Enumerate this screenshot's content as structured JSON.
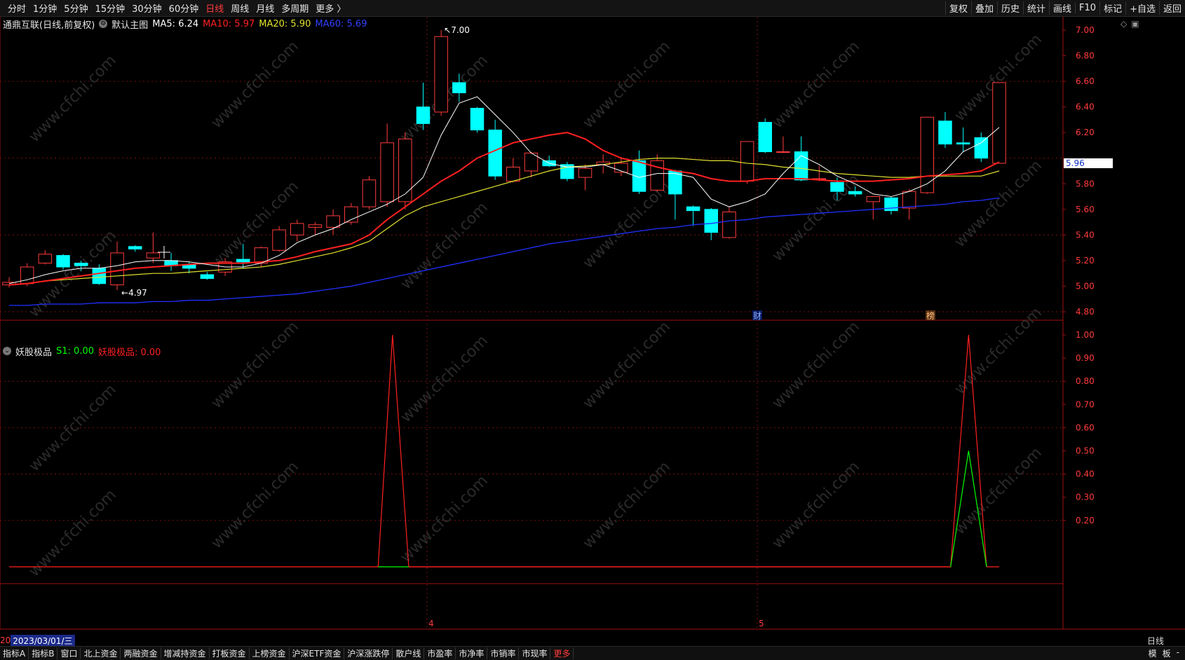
{
  "toolbar": {
    "periods": [
      "分时",
      "1分钟",
      "5分钟",
      "15分钟",
      "30分钟",
      "60分钟",
      "日线",
      "周线",
      "月线",
      "多周期",
      "更多 〉"
    ],
    "active_period_index": 6,
    "tools": [
      "复权",
      "叠加",
      "历史",
      "统计",
      "画线",
      "F10",
      "标记",
      "+自选",
      "返回"
    ]
  },
  "main_legend": {
    "title": "通鼎互联(日线,前复权)",
    "indicator": "默认主图",
    "ma5": "MA5: 6.24",
    "ma10": "MA10: 5.97",
    "ma20": "MA20: 5.90",
    "ma60": "MA60: 5.69"
  },
  "sub_legend": {
    "name": "妖股极品",
    "s1": "S1: 0.00",
    "value": "妖股极品: 0.00"
  },
  "annotations": {
    "high": "7.00",
    "low": "4.97",
    "badge_cai": "财",
    "badge_bang": "榜"
  },
  "price_axis_labels": [
    "7.00",
    "6.80",
    "6.60",
    "6.40",
    "6.20",
    "5.80",
    "5.60",
    "5.40",
    "5.20",
    "5.00",
    "4.80"
  ],
  "current_price": "5.96",
  "sub_axis_labels": [
    "1.00",
    "0.90",
    "0.80",
    "0.70",
    "0.60",
    "0.50",
    "0.40",
    "0.30",
    "0.20"
  ],
  "x_axis": {
    "date_prefix": "20",
    "date": "2023/03/01/三",
    "month_labels": [
      "4",
      "5"
    ],
    "period": "日线"
  },
  "bottom_tabs": [
    "指标A",
    "指标B",
    "窗口",
    "北上资金",
    "两融资金",
    "增减持资金",
    "打板资金",
    "上榜资金",
    "沪深ETF资金",
    "沪深涨跌停",
    "散户线",
    "市盈率",
    "市净率",
    "市销率",
    "市现率",
    "更多"
  ],
  "bottom_right": [
    "模",
    "板",
    "-"
  ],
  "colors": {
    "up": "#ff3b3b",
    "down": "#00ffff",
    "ma5": "#ffffff",
    "ma10": "#ff2020",
    "ma20": "#e0e030",
    "ma60": "#2030ff",
    "signal_red": "#ff2020",
    "signal_green": "#00ff00"
  },
  "chart_data": {
    "type": "candlestick",
    "price_range": [
      4.8,
      7.0
    ],
    "candles": [
      [
        5.01,
        5.03,
        4.99,
        5.07
      ],
      [
        5.02,
        5.15,
        5.0,
        5.18
      ],
      [
        5.18,
        5.25,
        5.17,
        5.28
      ],
      [
        5.24,
        5.15,
        5.13,
        5.25
      ],
      [
        5.18,
        5.16,
        5.12,
        5.2
      ],
      [
        5.14,
        5.02,
        5.01,
        5.17
      ],
      [
        5.01,
        5.26,
        4.97,
        5.35
      ],
      [
        5.31,
        5.29,
        5.27,
        5.32
      ],
      [
        5.22,
        5.26,
        5.18,
        5.42
      ],
      [
        5.2,
        5.16,
        5.12,
        5.26
      ],
      [
        5.17,
        5.14,
        5.1,
        5.19
      ],
      [
        5.09,
        5.06,
        5.05,
        5.11
      ],
      [
        5.11,
        5.19,
        5.08,
        5.22
      ],
      [
        5.21,
        5.19,
        5.14,
        5.33
      ],
      [
        5.18,
        5.3,
        5.15,
        5.31
      ],
      [
        5.28,
        5.44,
        5.27,
        5.47
      ],
      [
        5.4,
        5.49,
        5.35,
        5.52
      ],
      [
        5.46,
        5.48,
        5.4,
        5.5
      ],
      [
        5.46,
        5.55,
        5.4,
        5.6
      ],
      [
        5.5,
        5.62,
        5.48,
        5.65
      ],
      [
        5.62,
        5.83,
        5.6,
        5.86
      ],
      [
        5.66,
        6.12,
        5.62,
        6.27
      ],
      [
        5.66,
        6.15,
        5.6,
        6.2
      ],
      [
        6.4,
        6.27,
        6.22,
        6.59
      ],
      [
        6.36,
        6.95,
        6.33,
        7.0
      ],
      [
        6.59,
        6.51,
        6.44,
        6.66
      ],
      [
        6.39,
        6.22,
        6.2,
        6.4
      ],
      [
        6.22,
        5.86,
        5.83,
        6.3
      ],
      [
        5.82,
        5.93,
        5.81,
        6.0
      ],
      [
        5.9,
        6.04,
        5.85,
        6.05
      ],
      [
        5.98,
        5.94,
        5.93,
        6.02
      ],
      [
        5.95,
        5.84,
        5.82,
        5.97
      ],
      [
        5.85,
        5.92,
        5.75,
        5.95
      ],
      [
        5.95,
        5.97,
        5.88,
        6.03
      ],
      [
        5.89,
        5.96,
        5.86,
        6.01
      ],
      [
        5.98,
        5.74,
        5.72,
        6.06
      ],
      [
        5.75,
        5.98,
        5.74,
        6.03
      ],
      [
        5.9,
        5.72,
        5.52,
        5.91
      ],
      [
        5.62,
        5.59,
        5.47,
        5.63
      ],
      [
        5.6,
        5.42,
        5.36,
        5.61
      ],
      [
        5.38,
        5.58,
        5.37,
        5.62
      ],
      [
        5.82,
        6.13,
        5.8,
        6.13
      ],
      [
        6.28,
        6.05,
        6.04,
        6.31
      ],
      [
        6.05,
        6.05,
        6.04,
        6.17
      ],
      [
        6.05,
        5.83,
        5.82,
        6.17
      ],
      [
        5.84,
        5.84,
        5.82,
        5.94
      ],
      [
        5.81,
        5.74,
        5.67,
        5.85
      ],
      [
        5.74,
        5.72,
        5.7,
        5.78
      ],
      [
        5.66,
        5.7,
        5.52,
        5.7
      ],
      [
        5.69,
        5.59,
        5.56,
        5.7
      ],
      [
        5.61,
        5.74,
        5.52,
        5.76
      ],
      [
        5.73,
        6.32,
        5.72,
        6.32
      ],
      [
        6.29,
        6.11,
        6.08,
        6.36
      ],
      [
        6.12,
        6.11,
        6.05,
        6.24
      ],
      [
        6.16,
        6.0,
        5.97,
        6.2
      ],
      [
        5.96,
        6.59,
        5.96,
        6.59
      ]
    ],
    "ma5": [
      5.02,
      5.05,
      5.09,
      5.12,
      5.14,
      5.14,
      5.16,
      5.19,
      5.2,
      5.2,
      5.19,
      5.17,
      5.15,
      5.15,
      5.18,
      5.24,
      5.34,
      5.4,
      5.45,
      5.52,
      5.58,
      5.64,
      5.72,
      5.85,
      6.18,
      6.43,
      6.48,
      6.34,
      6.2,
      6.04,
      5.96,
      5.93,
      5.93,
      5.95,
      5.9,
      5.85,
      5.88,
      5.88,
      5.85,
      5.68,
      5.62,
      5.66,
      5.72,
      5.88,
      6.02,
      5.95,
      5.86,
      5.8,
      5.72,
      5.7,
      5.74,
      5.8,
      5.9,
      6.05,
      6.12,
      6.24
    ],
    "ma10": [
      5.01,
      5.02,
      5.04,
      5.06,
      5.08,
      5.1,
      5.12,
      5.14,
      5.15,
      5.16,
      5.17,
      5.18,
      5.18,
      5.18,
      5.19,
      5.2,
      5.23,
      5.27,
      5.3,
      5.33,
      5.4,
      5.52,
      5.62,
      5.72,
      5.82,
      5.9,
      6.0,
      6.06,
      6.12,
      6.15,
      6.18,
      6.2,
      6.15,
      6.06,
      6.0,
      5.97,
      5.93,
      5.9,
      5.88,
      5.84,
      5.82,
      5.82,
      5.84,
      5.84,
      5.84,
      5.83,
      5.82,
      5.82,
      5.82,
      5.83,
      5.84,
      5.86,
      5.87,
      5.88,
      5.9,
      5.97
    ],
    "ma20": [
      5.01,
      5.02,
      5.04,
      5.05,
      5.06,
      5.07,
      5.08,
      5.09,
      5.1,
      5.1,
      5.11,
      5.12,
      5.13,
      5.14,
      5.15,
      5.17,
      5.2,
      5.23,
      5.26,
      5.3,
      5.35,
      5.45,
      5.55,
      5.62,
      5.66,
      5.7,
      5.74,
      5.78,
      5.82,
      5.86,
      5.9,
      5.93,
      5.94,
      5.95,
      5.97,
      5.99,
      6.0,
      6.0,
      5.99,
      5.98,
      5.98,
      5.96,
      5.95,
      5.93,
      5.92,
      5.9,
      5.88,
      5.87,
      5.86,
      5.85,
      5.85,
      5.86,
      5.86,
      5.86,
      5.86,
      5.9
    ],
    "ma60": [
      4.85,
      4.85,
      4.86,
      4.86,
      4.86,
      4.87,
      4.87,
      4.87,
      4.88,
      4.88,
      4.89,
      4.89,
      4.9,
      4.91,
      4.92,
      4.93,
      4.94,
      4.96,
      4.98,
      5.0,
      5.03,
      5.06,
      5.09,
      5.12,
      5.15,
      5.18,
      5.21,
      5.24,
      5.27,
      5.3,
      5.33,
      5.35,
      5.37,
      5.39,
      5.41,
      5.43,
      5.45,
      5.46,
      5.48,
      5.49,
      5.51,
      5.52,
      5.54,
      5.55,
      5.56,
      5.57,
      5.58,
      5.59,
      5.6,
      5.61,
      5.62,
      5.63,
      5.64,
      5.66,
      5.67,
      5.69
    ],
    "sub_signal_red": [
      [
        20.5,
        0
      ],
      [
        21.3,
        1
      ],
      [
        22.2,
        0
      ],
      [
        52.3,
        0
      ],
      [
        53.3,
        1
      ],
      [
        54.3,
        0
      ]
    ],
    "sub_signal_green": [
      [
        52.3,
        0
      ],
      [
        53.3,
        0.5
      ],
      [
        54.3,
        0
      ]
    ],
    "sub_range": [
      0,
      1.05
    ]
  }
}
